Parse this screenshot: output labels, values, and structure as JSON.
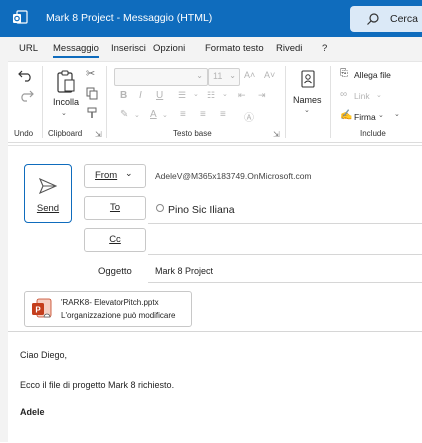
{
  "titlebar": {
    "title": "Mark 8 Project  -  Messaggio (HTML)",
    "search_label": "Cerca",
    "accent": "#0f6cbd"
  },
  "tabs": [
    "URL",
    "Messaggio",
    "Inserisci",
    "Opzioni",
    "Formato testo",
    "Rivedi",
    "?"
  ],
  "ribbon": {
    "undo_group": "Undo",
    "clipboard_group": "Clipboard",
    "paste_label": "Incolla",
    "font_size": "11",
    "basic_text_group": "Testo base",
    "names_label": "Names",
    "attach_label": "Allega file",
    "link_label": "Link",
    "signature_label": "Firma",
    "include_group": "Include"
  },
  "compose": {
    "send_label": "Send",
    "from_label": "From",
    "from_address": "AdeleV@M365x183749.OnMicrosoft.com",
    "to_label": "To",
    "to_recipient": "Pino Sic Iliana",
    "cc_label": "Cc",
    "subject_label": "Oggetto",
    "subject_value": "Mark 8 Project"
  },
  "attachment": {
    "name": "'RARK8- ElevatorPitch.pptx",
    "note": "L'organizzazione può modificare"
  },
  "body": {
    "greeting": "Ciao Diego,",
    "line": "Ecco il file di progetto Mark 8 richiesto.",
    "signature": "Adele"
  }
}
